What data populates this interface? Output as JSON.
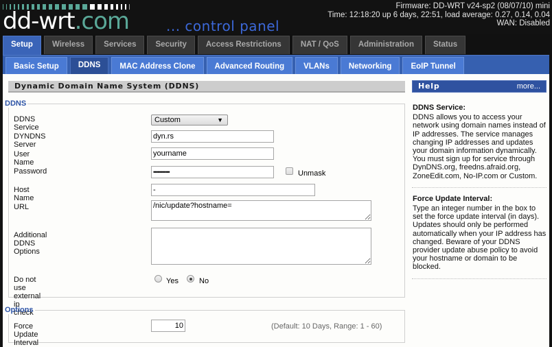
{
  "header": {
    "logo_main": "dd-wrt",
    "logo_suffix": ".com",
    "tagline": "... control panel",
    "firmware": "Firmware: DD-WRT v24-sp2 (08/07/10) mini",
    "time": "Time: 12:18:20 up 6 days, 22:51, load average: 0.27, 0.14, 0.04",
    "wan": "WAN: Disabled"
  },
  "main_tabs": [
    {
      "label": "Setup",
      "active": true
    },
    {
      "label": "Wireless"
    },
    {
      "label": "Services"
    },
    {
      "label": "Security"
    },
    {
      "label": "Access Restrictions"
    },
    {
      "label": "NAT / QoS"
    },
    {
      "label": "Administration"
    },
    {
      "label": "Status"
    }
  ],
  "sub_tabs": [
    {
      "label": "Basic Setup"
    },
    {
      "label": "DDNS",
      "active": true
    },
    {
      "label": "MAC Address Clone"
    },
    {
      "label": "Advanced Routing"
    },
    {
      "label": "VLANs"
    },
    {
      "label": "Networking"
    },
    {
      "label": "EoIP Tunnel"
    }
  ],
  "section_title": "Dynamic Domain Name System (DDNS)",
  "ddns": {
    "legend": "DDNS",
    "service_label": "DDNS Service",
    "service_value": "Custom",
    "server_label": "DYNDNS Server",
    "server_value": "dyn.rs",
    "username_label": "User Name",
    "username_value": "yourname",
    "password_label": "Password",
    "password_value": "•••••••••••",
    "unmask_label": "Unmask",
    "unmask_checked": false,
    "hostname_label": "Host Name",
    "hostname_value": "-",
    "url_label": "URL",
    "url_value": "/nic/update?hostname=",
    "options_label": "Additional DDNS Options",
    "options_value": "",
    "extip_label": "Do not use external ip check",
    "extip_yes": "Yes",
    "extip_no": "No",
    "extip_selected": "No"
  },
  "options": {
    "legend": "Options",
    "force_label": "Force Update Interval",
    "force_value": "10",
    "force_hint": "(Default: 10 Days, Range: 1 - 60)"
  },
  "help": {
    "title": "Help",
    "more": "more...",
    "blocks": [
      {
        "heading": "DDNS Service:",
        "text": "DDNS allows you to access your network using domain names instead of IP addresses. The service manages changing IP addresses and updates your domain information dynamically. You must sign up for service through DynDNS.org, freedns.afraid.org, ZoneEdit.com, No-IP.com or Custom."
      },
      {
        "heading": "Force Update Interval:",
        "text": "Type an integer number in the box to set the force update interval (in days). Updates should only be performed automatically when your IP address has changed. Beware of your DDNS provider update abuse policy to avoid your hostname or domain to be blocked."
      }
    ]
  },
  "colors": {
    "accent_blue": "#3a64b8",
    "logo_teal": "#5aa898",
    "tagline_blue": "#3c68d8",
    "legend_blue": "#2c53a6"
  }
}
